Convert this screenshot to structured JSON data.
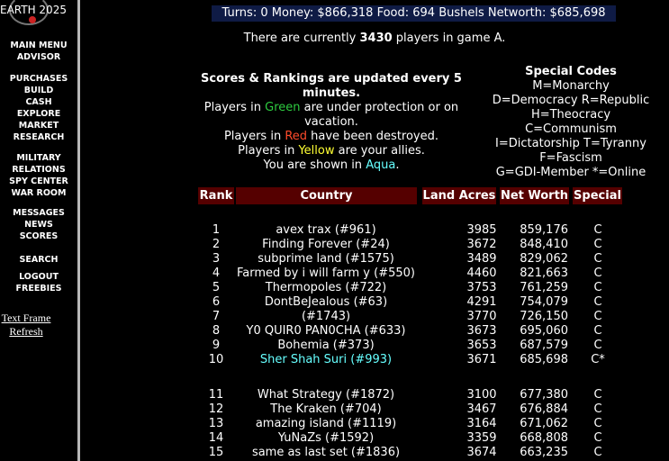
{
  "sidebar": {
    "logo_text": "EARTH 2025",
    "items": [
      {
        "label": "MAIN MENU"
      },
      {
        "label": "ADVISOR"
      },
      {
        "label": "PURCHASES"
      },
      {
        "label": "BUILD"
      },
      {
        "label": "CASH"
      },
      {
        "label": "EXPLORE"
      },
      {
        "label": "MARKET"
      },
      {
        "label": "RESEARCH"
      },
      {
        "label": "MILITARY"
      },
      {
        "label": "RELATIONS"
      },
      {
        "label": "SPY CENTER"
      },
      {
        "label": "WAR ROOM"
      },
      {
        "label": "MESSAGES"
      },
      {
        "label": "NEWS"
      },
      {
        "label": "SCORES"
      },
      {
        "label": "SEARCH"
      },
      {
        "label": "LOGOUT"
      },
      {
        "label": "FREEBIES"
      }
    ],
    "links": [
      {
        "label": "Text Frame"
      },
      {
        "label": "Refresh"
      }
    ]
  },
  "status_bar": "Turns: 0 Money: $866,318 Food: 694 Bushels Networth: $685,698",
  "players_line": {
    "prefix": "There are currently ",
    "count": "3430",
    "suffix": " players in game A."
  },
  "scores_info": {
    "heading": "Scores & Rankings are updated every 5 minutes.",
    "green_pre": "Players in ",
    "green_word": "Green",
    "green_post": " are under protection or on vacation.",
    "red_pre": "Players in ",
    "red_word": "Red",
    "red_post": " have been destroyed.",
    "yellow_pre": "Players in ",
    "yellow_word": "Yellow",
    "yellow_post": " are your allies.",
    "aqua_pre": "You are shown in ",
    "aqua_word": "Aqua",
    "aqua_post": "."
  },
  "special_codes": {
    "heading": "Special Codes",
    "lines": [
      "M=Monarchy",
      "D=Democracy R=Republic",
      "H=Theocracy",
      "C=Communism",
      "I=Dictatorship T=Tyranny",
      "F=Fascism",
      "G=GDI-Member *=Online"
    ]
  },
  "colors": {
    "header_bg": "#550000",
    "stats_bg": "#0f1b45",
    "aqua": "#66ffff",
    "green": "#2ecc40",
    "red": "#ff4b2b",
    "yellow": "#ffff33"
  },
  "table": {
    "headers": {
      "rank": "Rank",
      "country": "Country",
      "land": "Land Acres",
      "networth": "Net Worth",
      "special": "Special"
    },
    "rows": [
      {
        "rank": "1",
        "country": "avex trax (#961)",
        "land": "3985",
        "networth": "859,176",
        "special": "C",
        "self": false
      },
      {
        "rank": "2",
        "country": "Finding Forever (#24)",
        "land": "3672",
        "networth": "848,410",
        "special": "C",
        "self": false
      },
      {
        "rank": "3",
        "country": "subprime land (#1575)",
        "land": "3489",
        "networth": "829,062",
        "special": "C",
        "self": false
      },
      {
        "rank": "4",
        "country": "Farmed by i will farm y (#550)",
        "land": "4460",
        "networth": "821,663",
        "special": "C",
        "self": false
      },
      {
        "rank": "5",
        "country": "Thermopoles (#722)",
        "land": "3753",
        "networth": "761,259",
        "special": "C",
        "self": false
      },
      {
        "rank": "6",
        "country": "DontBeJealous (#63)",
        "land": "4291",
        "networth": "754,079",
        "special": "C",
        "self": false
      },
      {
        "rank": "7",
        "country": "(#1743)",
        "land": "3770",
        "networth": "726,150",
        "special": "C",
        "self": false
      },
      {
        "rank": "8",
        "country": "Y0 QUIR0 PAN0CHA (#633)",
        "land": "3673",
        "networth": "695,060",
        "special": "C",
        "self": false
      },
      {
        "rank": "9",
        "country": "Bohemia (#373)",
        "land": "3653",
        "networth": "687,579",
        "special": "C",
        "self": false
      },
      {
        "rank": "10",
        "country": "Sher Shah Suri (#993)",
        "land": "3671",
        "networth": "685,698",
        "special": "C*",
        "self": true
      },
      {
        "rank": "11",
        "country": "What Strategy (#1872)",
        "land": "3100",
        "networth": "677,380",
        "special": "C",
        "self": false
      },
      {
        "rank": "12",
        "country": "The Kraken (#704)",
        "land": "3467",
        "networth": "676,884",
        "special": "C",
        "self": false
      },
      {
        "rank": "13",
        "country": "amazing island (#1119)",
        "land": "3164",
        "networth": "671,062",
        "special": "C",
        "self": false
      },
      {
        "rank": "14",
        "country": "YuNaZs (#1592)",
        "land": "3359",
        "networth": "668,808",
        "special": "C",
        "self": false
      },
      {
        "rank": "15",
        "country": "same as last set (#1836)",
        "land": "3674",
        "networth": "663,235",
        "special": "C",
        "self": false
      }
    ]
  }
}
